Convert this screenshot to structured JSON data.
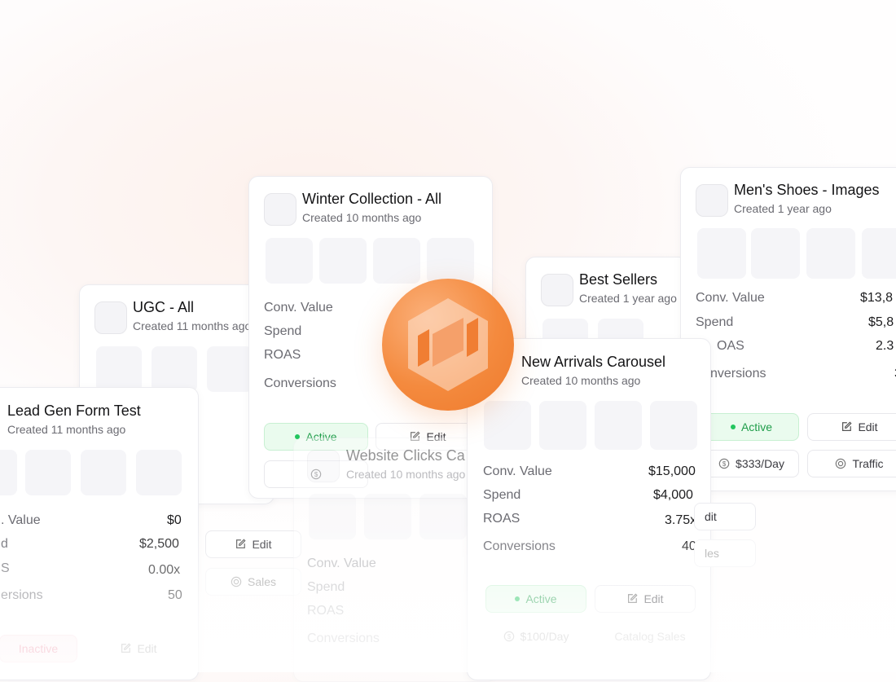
{
  "labels": {
    "conv_value": "Conv. Value",
    "spend": "Spend",
    "roas": "ROAS",
    "conversions": "Conversions",
    "edit": "Edit",
    "active": "Active"
  },
  "cards": {
    "winter": {
      "title": "Winter Collection - All",
      "created": "Created 10 months ago"
    },
    "ugc": {
      "title": "UGC - All",
      "created": "Created 11 months ago"
    },
    "lead": {
      "title": "Lead Gen Form Test",
      "created": "Created 11 months ago",
      "conv_value": "$0",
      "spend": "$2,500",
      "roas": "0.00x",
      "conversions": "50",
      "status": "Inactive",
      "objective": "Sales",
      "conv_value_label": ". Value",
      "spend_label": "d",
      "roas_label": "S",
      "conversions_label": "ersions"
    },
    "website": {
      "title": "Website Clicks Ca",
      "created": "Created 10 months ago"
    },
    "best": {
      "title": "Best Sellers",
      "created": "Created 1 year ago"
    },
    "arrivals": {
      "title": "New Arrivals Carousel",
      "created": "Created 10 months ago",
      "conv_value": "$15,000",
      "spend": "$4,000",
      "roas": "3.75x",
      "conversions": "40",
      "budget": "$100/Day",
      "objective": "Catalog Sales"
    },
    "shoes": {
      "title": "Men's Shoes - Images",
      "created": "Created 1 year ago",
      "conv_value": "$13,8",
      "spend": "$5,8",
      "roas": "2.3",
      "conversions": "3",
      "budget": "$333/Day",
      "objective": "Traffic",
      "roas_label": "OAS",
      "conversions_label": "nversions"
    }
  },
  "colors": {
    "accent": "#f48a3e",
    "active": "#22c55e",
    "inactive": "#e55b7a"
  }
}
